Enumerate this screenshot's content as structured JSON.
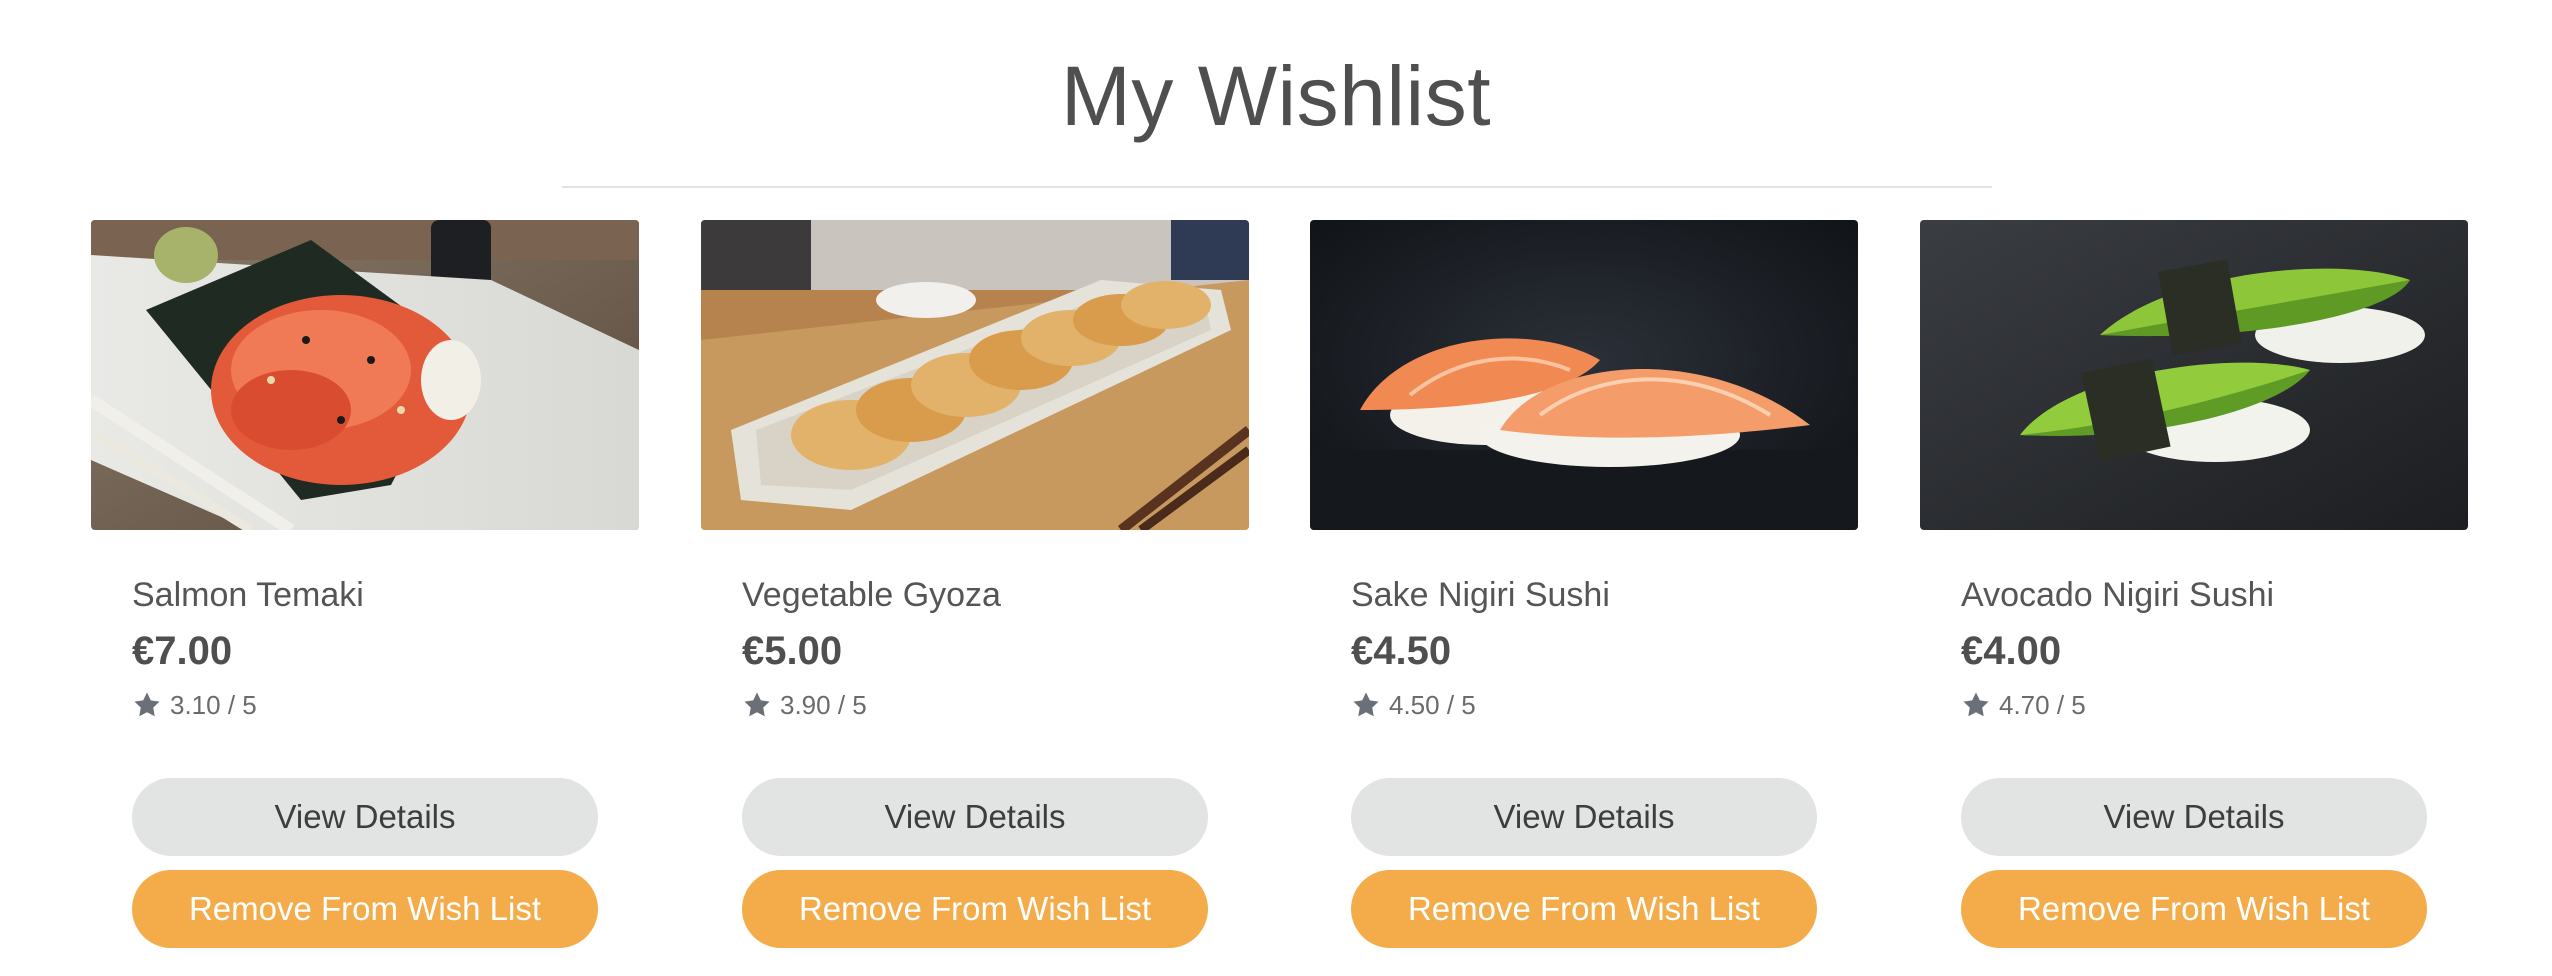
{
  "page": {
    "title": "My Wishlist"
  },
  "items": [
    {
      "name": "Salmon Temaki",
      "price": "€7.00",
      "rating": "3.10 / 5",
      "details_label": "View Details",
      "remove_label": "Remove From Wish List",
      "image_alt": "salmon-temaki-photo"
    },
    {
      "name": "Vegetable Gyoza",
      "price": "€5.00",
      "rating": "3.90 / 5",
      "details_label": "View Details",
      "remove_label": "Remove From Wish List",
      "image_alt": "vegetable-gyoza-photo"
    },
    {
      "name": "Sake Nigiri Sushi",
      "price": "€4.50",
      "rating": "4.50 / 5",
      "details_label": "View Details",
      "remove_label": "Remove From Wish List",
      "image_alt": "sake-nigiri-photo"
    },
    {
      "name": "Avocado Nigiri Sushi",
      "price": "€4.00",
      "rating": "4.70 / 5",
      "details_label": "View Details",
      "remove_label": "Remove From Wish List",
      "image_alt": "avocado-nigiri-photo"
    }
  ],
  "colors": {
    "accent": "#f4ac4a",
    "secondary_button": "#e2e3e3",
    "text": "#505050",
    "star": "#6b6f78"
  },
  "icons": {
    "rating": "star-icon"
  }
}
